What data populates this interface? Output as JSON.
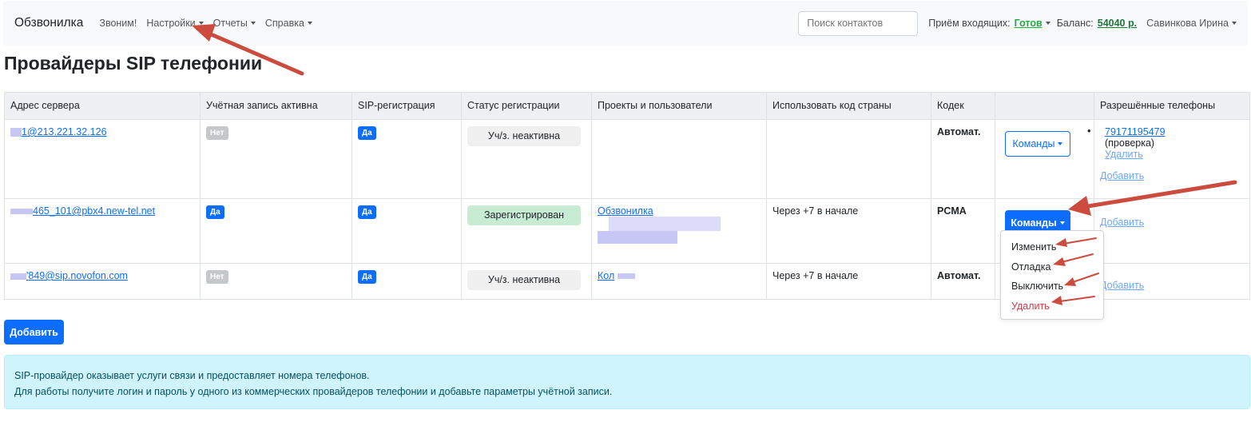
{
  "nav": {
    "brand": "Обзвонилка",
    "links": [
      "Звоним!",
      "Настройки",
      "Отчеты",
      "Справка"
    ],
    "search_placeholder": "Поиск контактов",
    "incoming_label": "Приём входящих:",
    "incoming_status": "Готов",
    "balance_label": "Баланс:",
    "balance_value": "54040 р.",
    "user": "Савинкова Ирина"
  },
  "page_title": "Провайдеры SIP телефонии",
  "table": {
    "headers": [
      "Адрес сервера",
      "Учётная запись активна",
      "SIP-регистрация",
      "Статус регистрации",
      "Проекты и пользователи",
      "Использовать код страны",
      "Кодек",
      "",
      "Разрешённые телефоны"
    ],
    "rows": [
      {
        "server": "1@213.221.32.126",
        "active": "Нет",
        "sip_reg": "Да",
        "status": "Уч/з. неактивна",
        "projects": "",
        "country_code": "",
        "codec": "Автомат.",
        "commands": "Команды",
        "phones": [
          "79171195479",
          "(проверка)",
          "Удалить",
          "Добавить"
        ]
      },
      {
        "server": "465_101@pbx4.new-tel.net",
        "active": "Да",
        "sip_reg": "Да",
        "status": "Зарегистрирован",
        "projects": "Обзвонилка",
        "country_code": "Через +7 в начале",
        "codec": "PCMA",
        "commands": "Команды",
        "phones": [
          "Добавить"
        ]
      },
      {
        "server": "'849@sip.novofon.com",
        "active": "Нет",
        "sip_reg": "Да",
        "status": "Уч/з. неактивна",
        "projects": "Кол",
        "country_code": "Через +7 в начале",
        "codec": "Автомат.",
        "commands": "",
        "phones": [
          "Добавить"
        ]
      }
    ]
  },
  "dropdown": [
    "Изменить",
    "Отладка",
    "Выключить",
    "Удалить"
  ],
  "add_button": "Добавить",
  "info": [
    "SIP-провайдер оказывает услуги связи и предоставляет номера телефонов.",
    "Для работы получите логин и пароль у одного из коммерческих провайдеров телефонии и добавьте параметры учётной записи."
  ],
  "colors": {
    "primary": "#0d6efd",
    "success_text": "#28a745",
    "registered_bg": "#c8ecd3",
    "info_bg": "#cff4fc",
    "danger": "#dc3545",
    "annotation_arrow": "#cd4b3e"
  }
}
